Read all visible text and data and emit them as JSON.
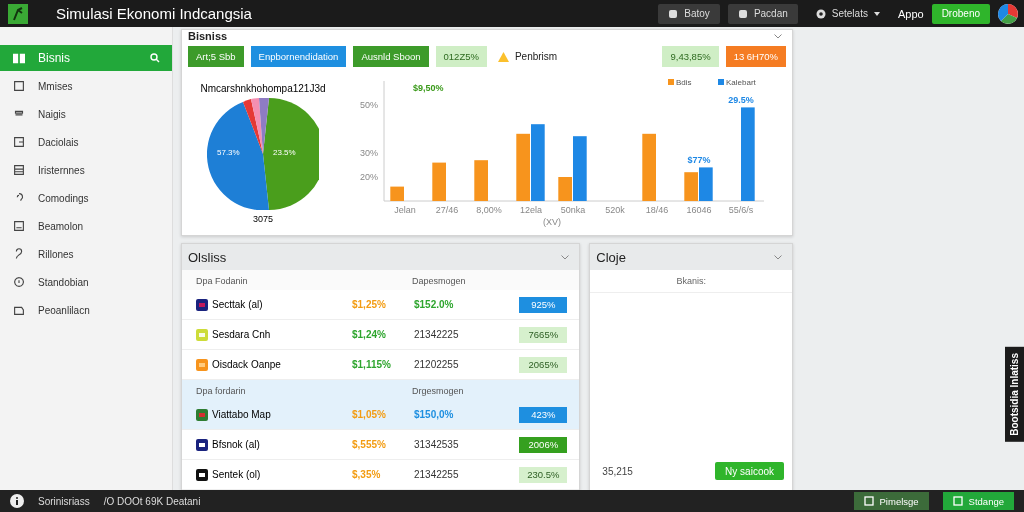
{
  "window": {
    "title": "Simulasi Ekonomi Indcangsia"
  },
  "top_actions": [
    {
      "label": "Batoy",
      "kind": "icon"
    },
    {
      "label": "Pacdan",
      "kind": "icon"
    },
    {
      "label": "Setelats",
      "kind": "menu"
    }
  ],
  "app_label": "Appo",
  "primary_button": "Drobeno",
  "sidebar": {
    "items": [
      {
        "label": "Bisnis",
        "selected": true
      },
      {
        "label": "Mmises",
        "selected": false
      },
      {
        "label": "Naigis",
        "selected": false
      },
      {
        "label": "Daciolais",
        "selected": false
      },
      {
        "label": "Iristernnes",
        "selected": false
      },
      {
        "label": "Comodings",
        "selected": false
      },
      {
        "label": "Beamolon",
        "selected": false
      },
      {
        "label": "Rillones",
        "selected": false
      },
      {
        "label": "Standobian",
        "selected": false
      },
      {
        "label": "Peoanlilacn",
        "selected": false
      }
    ]
  },
  "main_panel": {
    "title": "Bisniss",
    "chips": [
      {
        "label": "Art;5 Sbb",
        "kind": "green"
      },
      {
        "label": "Enpbornendidation",
        "kind": "blue"
      },
      {
        "label": "Ausnld Sboon",
        "kind": "green"
      },
      {
        "label": "012Z5%",
        "kind": "light"
      },
      {
        "label": "Penbrism",
        "kind": "warning"
      },
      {
        "label": "9,43,85%",
        "kind": "light"
      },
      {
        "label": "13 6H70%",
        "kind": "orange"
      }
    ],
    "pie": {
      "title": "Nmcarshnkhohompa121J3d",
      "slice_labels": [
        "57.3%",
        "23.5%"
      ],
      "caption": "3075"
    },
    "chart_data": {
      "type": "bar",
      "categories": [
        "Jelan",
        "27/46",
        "8,00%",
        "12ela",
        "50nka",
        "520k",
        "18/46",
        "16046",
        "55/6/s"
      ],
      "xlabel": "(XV)",
      "series": [
        {
          "name": "Bdis",
          "color": "#f7941d",
          "values": [
            16,
            26,
            27,
            38,
            20,
            null,
            38,
            22,
            null
          ]
        },
        {
          "name": "Kalebart",
          "color": "#1e88e5",
          "values": [
            null,
            null,
            null,
            42,
            37,
            null,
            null,
            24,
            49
          ]
        }
      ],
      "legend": "upper right",
      "ylim": [
        10,
        60
      ],
      "yticks": [
        {
          "value": 20,
          "label": "20%"
        },
        {
          "value": 30,
          "label": "30%"
        },
        {
          "value": 50,
          "label": "50%"
        }
      ],
      "annotations": [
        "$9,50%",
        "$77%",
        "29.5%"
      ]
    }
  },
  "table_panel": {
    "title": "Olsliss",
    "groups": [
      {
        "highlighted": false,
        "headers": [
          "Dpa Fodanin",
          "Dapesmogen"
        ],
        "rows": [
          {
            "name": "Secttak (al)",
            "value_1": {
              "text": "$1,25%",
              "color": "#f39c12"
            },
            "value_2": {
              "text": "$152.0%",
              "color": "#2ea52e"
            },
            "badge": {
              "text": "925%",
              "kind": "blue"
            },
            "highlighted": false
          },
          {
            "name": "Sesdara Cnh",
            "value_1": {
              "text": "$1,24%",
              "color": "#2ea52e"
            },
            "value_2": {
              "text": "21342225"
            },
            "badge": {
              "text": "7665%",
              "kind": "light"
            },
            "highlighted": false
          },
          {
            "name": "Oisdack Oanpe",
            "value_1": {
              "text": "$1,115%",
              "color": "#2ea52e"
            },
            "value_2": {
              "text": "21202255"
            },
            "badge": {
              "text": "2065%",
              "kind": "light"
            },
            "highlighted": false
          }
        ]
      },
      {
        "highlighted": true,
        "headers": [
          "Dpa fordarin",
          "Drgesmogen"
        ],
        "rows": [
          {
            "name": "Viattabo Map",
            "value_1": {
              "text": "$1,05%",
              "color": "#f39c12"
            },
            "value_2": {
              "text": "$150,0%",
              "color": "#1e8fe0"
            },
            "badge": {
              "text": "423%",
              "kind": "blue"
            },
            "highlighted": true
          },
          {
            "name": "Bfsnok (al)",
            "value_1": {
              "text": "$,555%",
              "color": "#f39c12"
            },
            "value_2": {
              "text": "31342535"
            },
            "badge": {
              "text": "2006%",
              "kind": "green"
            },
            "highlighted": false
          },
          {
            "name": "Sentek (ol)",
            "value_1": {
              "text": "$,35%",
              "color": "#f39c12"
            },
            "value_2": {
              "text": "21342255"
            },
            "badge": {
              "text": "230.5%",
              "kind": "light"
            },
            "highlighted": false
          }
        ]
      }
    ]
  },
  "side_panel": {
    "title": "Cloje",
    "subtitle": "Bkanis:",
    "total": "35,215",
    "button": "Ny saicook"
  },
  "side_tab": "Bootsidia lnlatiss",
  "status_bar": {
    "label": "Sorinisriass",
    "info": "/O DOOt 69K Deatani",
    "buttons": [
      {
        "label": "Pimelsge",
        "kind": "outline"
      },
      {
        "label": "Stdange",
        "kind": "solid"
      }
    ]
  }
}
